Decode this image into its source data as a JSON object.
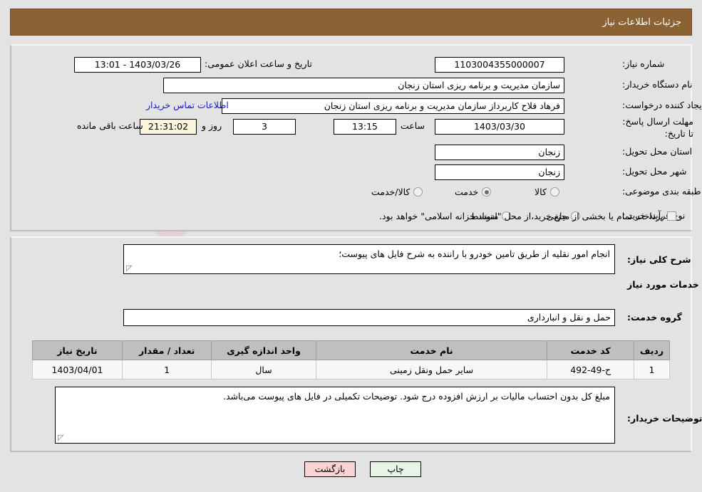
{
  "header": {
    "title": "جزئیات اطلاعات نیاز"
  },
  "top": {
    "need_number_label": "شماره نیاز:",
    "need_number_value": "1103004355000007",
    "public_announce_label": "تاریخ و ساعت اعلان عمومی:",
    "public_announce_value": "1403/03/26 - 13:01",
    "buyer_org_label": "نام دستگاه خریدار:",
    "buyer_org_value": "سازمان مدیریت و برنامه ریزی استان زنجان",
    "requester_label": "ایجاد کننده درخواست:",
    "requester_value": "فرهاد فلاح کاربرداز سازمان مدیریت و برنامه ریزی استان زنجان",
    "contact_link": "اطلاعات تماس خریدار",
    "deadline_label": "مهلت ارسال پاسخ: تا تاریخ:",
    "deadline_date": "1403/03/30",
    "hour_label": "ساعت",
    "deadline_time": "13:15",
    "days_value": "3",
    "days_label": "روز و",
    "countdown_value": "21:31:02",
    "remaining_label": "ساعت باقی مانده",
    "province_label": "استان محل تحویل:",
    "province_value": "زنجان",
    "city_label": "شهر محل تحویل:",
    "city_value": "زنجان",
    "classification_label": "طبقه بندی موضوعی:",
    "classification_options": [
      {
        "label": "کالا",
        "selected": false
      },
      {
        "label": "خدمت",
        "selected": true
      },
      {
        "label": "کالا/خدمت",
        "selected": false
      }
    ],
    "process_label": "نوع فرآیند خرید :",
    "process_options": [
      {
        "label": "جزیی",
        "selected": false
      },
      {
        "label": "متوسط",
        "selected": false
      }
    ],
    "treasury_checkbox_checked": false,
    "treasury_checkbox_label": "پرداخت تمام یا بخشی از مبلغ خرید،از محل \"اسناد خزانه اسلامی\" خواهد بود."
  },
  "middle": {
    "general_desc_label": "شرح کلی نیاز:",
    "general_desc_value": "انجام امور نقلیه از طریق تامین خودرو با راننده به شرح فایل های پیوست؛",
    "section_title": "اطلاعات خدمات مورد نیاز",
    "service_group_label": "گروه خدمت:",
    "service_group_value": "حمل و نقل و انبارداری",
    "table": {
      "columns": [
        "ردیف",
        "کد خدمت",
        "نام خدمت",
        "واحد اندازه گیری",
        "تعداد / مقدار",
        "تاریخ نیاز"
      ],
      "rows": [
        [
          "1",
          "ح-49-492",
          "سایر حمل ونقل زمینی",
          "سال",
          "1",
          "1403/04/01"
        ]
      ]
    },
    "buyer_notes_label": "توضیحات خریدار:",
    "buyer_notes_value": "مبلغ کل بدون احتساب مالیات بر ارزش افزوده درج شود. توضیحات تکمیلی در فایل های پیوست می‌باشد."
  },
  "footer": {
    "print_label": "چاپ",
    "back_label": "بازگشت"
  },
  "watermark": {
    "text_left": "Arta",
    "text_right": "Tender.net"
  },
  "colors": {
    "title_bar": "#8b6234",
    "page_bg": "#e3e3e3",
    "link": "#1515d6",
    "table_header": "#bfbfbf",
    "countdown_bg": "#fbf6dc",
    "print_btn": "#e6f5e6",
    "back_btn": "#fbd3d3"
  }
}
